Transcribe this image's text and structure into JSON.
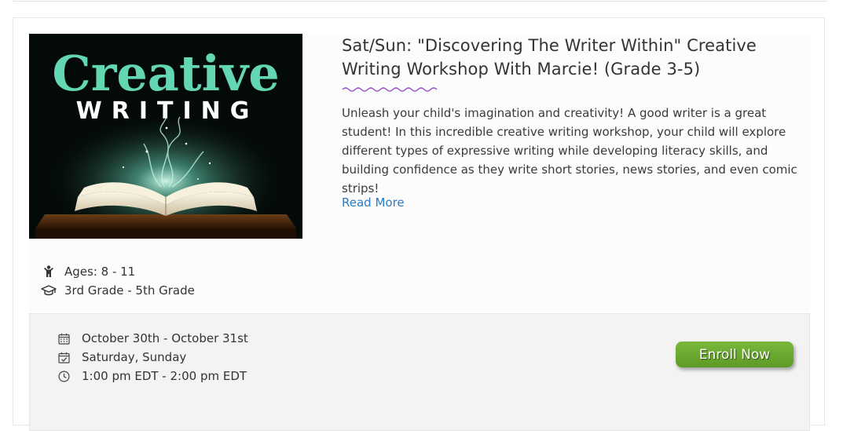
{
  "course": {
    "title": "Sat/Sun: \"Discovering The Writer Within\" Creative Writing Workshop With Marcie! (Grade 3-5)",
    "description": "Unleash your child's imagination and creativity! A good writer is a great student! In this incredible creative writing workshop, your child will explore different types of expressive writing while developing literacy skills, and building confidence as they write short stories, news stories, and even comic strips!",
    "read_more": "Read More",
    "image": {
      "line1": "Creative",
      "line2": "WRITING",
      "icon": "open-book-magic-image"
    },
    "ages": "Ages: 8 - 11",
    "grades": "3rd Grade - 5th Grade"
  },
  "schedule": {
    "dates": "October 30th - October 31st",
    "days": "Saturday, Sunday",
    "time": "1:00 pm EDT - 2:00 pm EDT"
  },
  "actions": {
    "enroll": "Enroll Now"
  },
  "colors": {
    "accent_squiggle": "#9b59d0",
    "link": "#2a7bc4",
    "enroll_green": "#6aa930",
    "image_text_teal": "#63d6b4"
  },
  "icons": [
    "child-icon",
    "graduation-cap-icon",
    "calendar-icon",
    "calendar-check-icon",
    "clock-icon"
  ]
}
